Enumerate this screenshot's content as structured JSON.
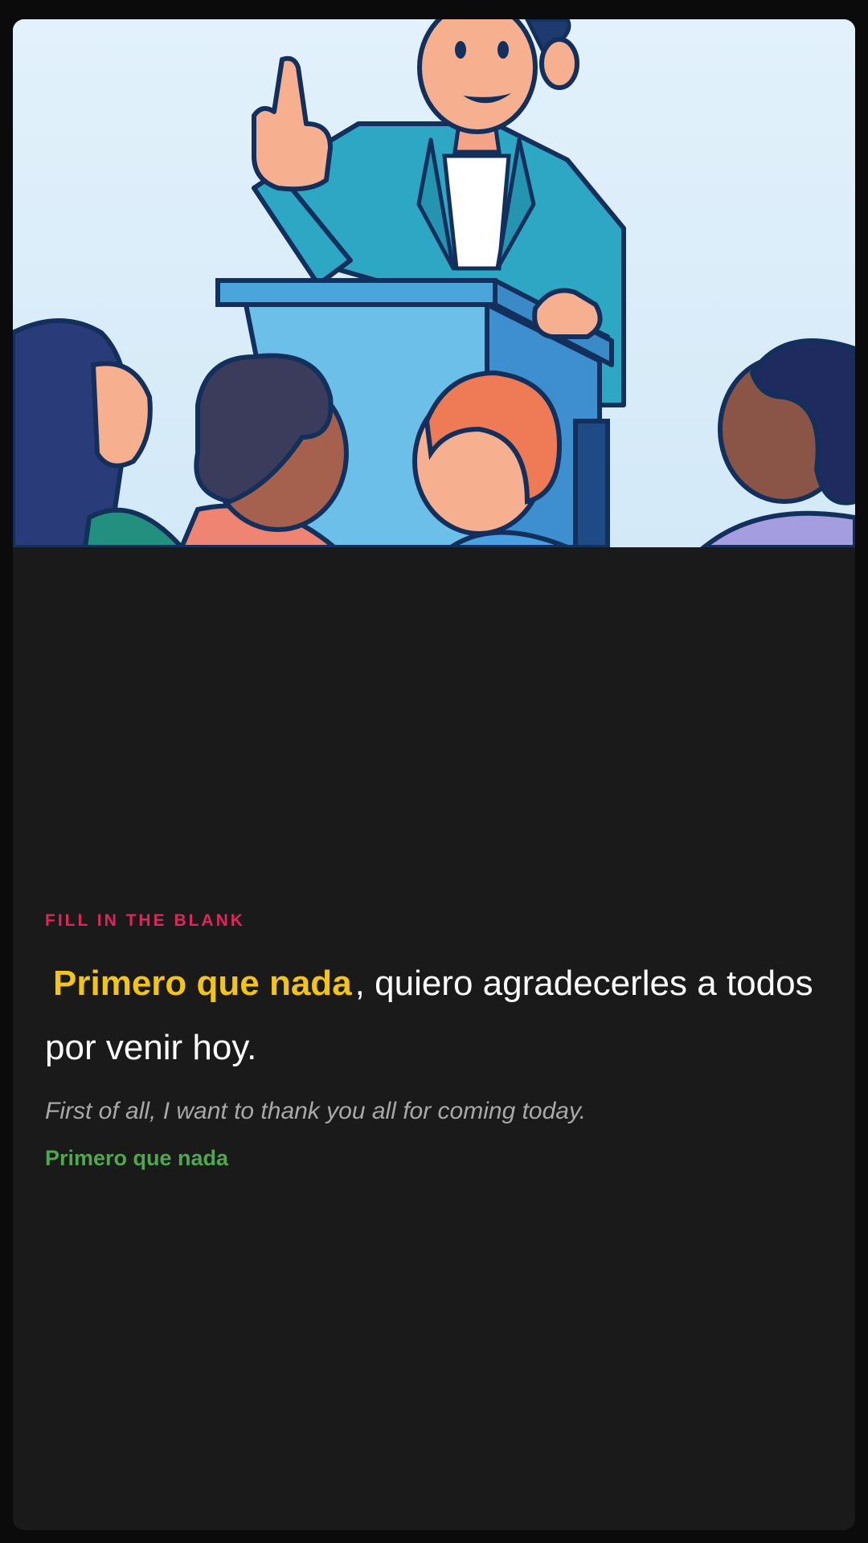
{
  "exercise": {
    "type_label": "FILL IN THE BLANK",
    "answer_phrase": "Primero que nada",
    "sentence_rest": ", quiero agradecerles a todos por venir hoy.",
    "translation": "First of all, I want to thank you all for coming today.",
    "correct_answer": "Primero que nada"
  },
  "illustration": {
    "icon": "speaker-at-podium-illustration"
  },
  "colors": {
    "background": "#1a1a1a",
    "type_label": "#e0255f",
    "answer_highlight": "#f2c318",
    "answer_reveal": "#4fa84f",
    "translation": "#a8a8a8"
  }
}
